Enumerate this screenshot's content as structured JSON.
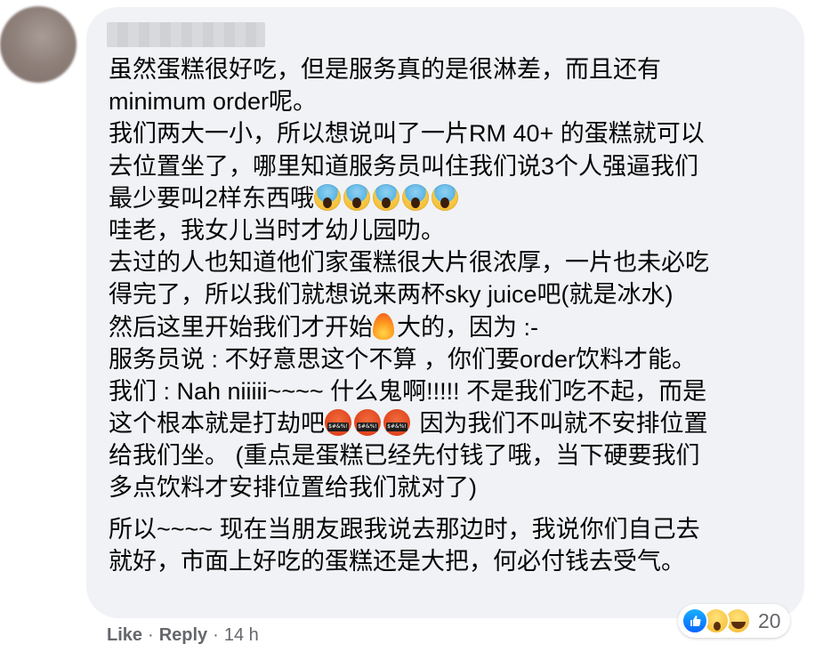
{
  "comment": {
    "lines": [
      "虽然蛋糕很好吃，但是服务真的是很淋差，而且还有",
      "minimum order呢。",
      "我们两大一小，所以想说叫了一片RM 40+ 的蛋糕就可以",
      "去位置坐了，哪里知道服务员叫住我们说3个人强逼我们",
      "最少要叫2样东西哦",
      "哇老，我女儿当时才幼儿园叻。",
      "去过的人也知道他们家蛋糕很大片很浓厚，一片也未必吃",
      "得完了，所以我们就想说来两杯sky juice吧(就是冰水)",
      "然后这里开始我们才开始",
      "大的，因为 :-",
      "服务员说 : 不好意思这个不算 ，你们要order饮料才能。",
      "我们 : Nah niiiii~~~~ 什么鬼啊!!!!! 不是我们吃不起，而是",
      "这个根本就是打劫吧",
      "因为我们不叫就不安排位置",
      "给我们坐。 (重点是蛋糕已经先付钱了哦，当下硬要我们",
      "多点饮料才安排位置给我们就对了)",
      "所以~~~~ 现在当朋友跟我说去那边时，我说你们自己去",
      "就好，市面上好吃的蛋糕还是大把，何必付钱去受气。"
    ]
  },
  "actions": {
    "like_label": "Like",
    "separator": "·",
    "reply_label": "Reply",
    "time": "14 h"
  },
  "reactions": {
    "icons": [
      "like-icon",
      "wow-icon",
      "haha-icon"
    ],
    "count": "20"
  },
  "colors": {
    "bubble": "#f0f2f5",
    "muted_text": "#65676b",
    "like_blue": "#0866ff"
  }
}
